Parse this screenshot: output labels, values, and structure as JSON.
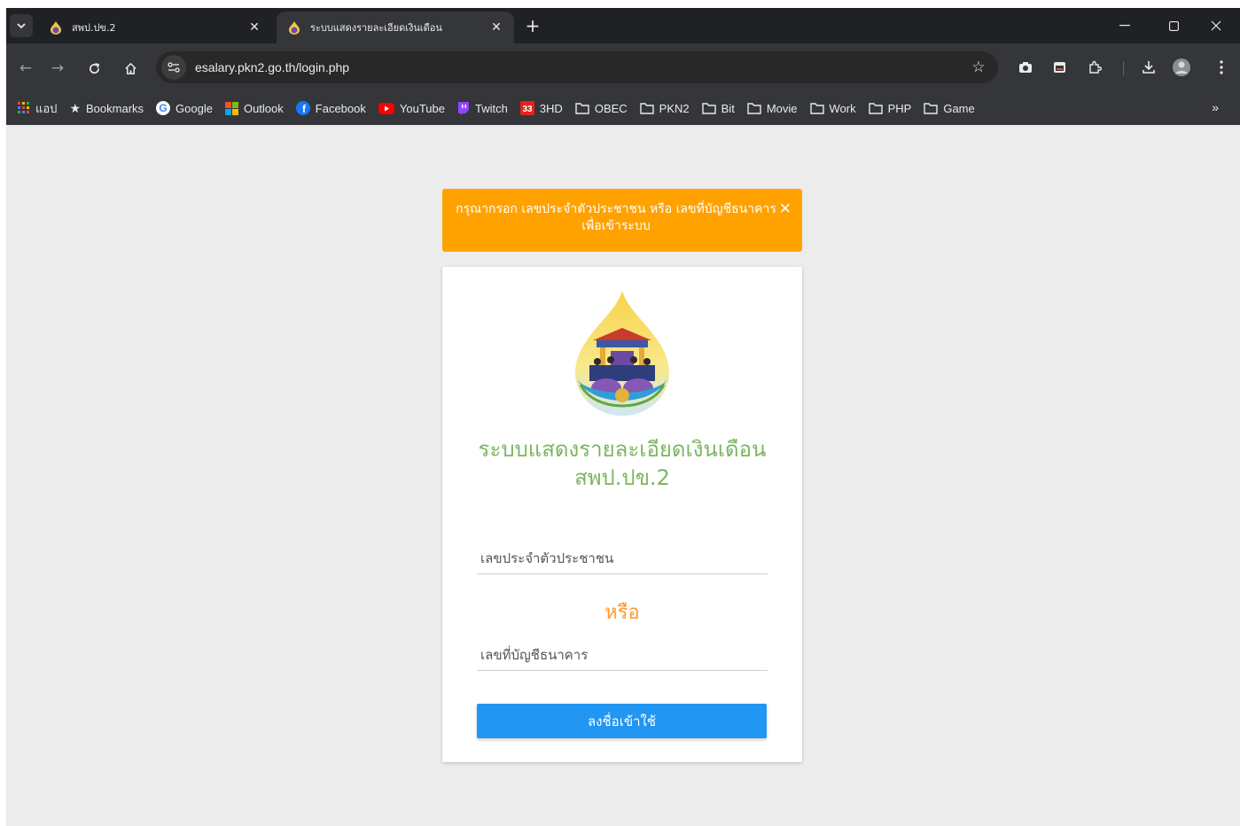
{
  "browser": {
    "tabs": [
      {
        "title": "สพป.ปข.2",
        "active": false
      },
      {
        "title": "ระบบแสดงรายละเอียดเงินเดือน",
        "active": true
      }
    ],
    "url": "esalary.pkn2.go.th/login.php",
    "bookmarks": [
      {
        "label": "แอป",
        "icon": "apps-grid-icon"
      },
      {
        "label": "Bookmarks",
        "icon": "star-icon"
      },
      {
        "label": "Google",
        "icon": "google-icon"
      },
      {
        "label": "Outlook",
        "icon": "windows-icon"
      },
      {
        "label": "Facebook",
        "icon": "facebook-icon"
      },
      {
        "label": "YouTube",
        "icon": "youtube-icon"
      },
      {
        "label": "Twitch",
        "icon": "twitch-icon"
      },
      {
        "label": "3HD",
        "icon": "tv-icon"
      },
      {
        "label": "OBEC",
        "icon": "folder-icon"
      },
      {
        "label": "PKN2",
        "icon": "folder-icon"
      },
      {
        "label": "Bit",
        "icon": "folder-icon"
      },
      {
        "label": "Movie",
        "icon": "folder-icon"
      },
      {
        "label": "Work",
        "icon": "folder-icon"
      },
      {
        "label": "PHP",
        "icon": "folder-icon"
      },
      {
        "label": "Game",
        "icon": "folder-icon"
      }
    ],
    "more_bookmarks": "»"
  },
  "alert": {
    "message": "กรุณากรอก เลขประจำตัวประชาชน หรือ เลขที่บัญชีธนาคาร เพื่อเข้าระบบ",
    "close": "✕"
  },
  "login": {
    "title_line1": "ระบบแสดงรายละเอียดเงินเดือน",
    "title_line2": "สพป.ปข.2",
    "citizen_id_placeholder": "เลขประจำตัวประชาชน",
    "or_label": "หรือ",
    "bank_account_placeholder": "เลขที่บัญชีธนาคาร",
    "submit_label": "ลงชื่อเข้าใช้"
  },
  "colors": {
    "alert": "#ffa200",
    "title": "#7cb661",
    "or": "#ff9a33",
    "button": "#2196f3"
  }
}
